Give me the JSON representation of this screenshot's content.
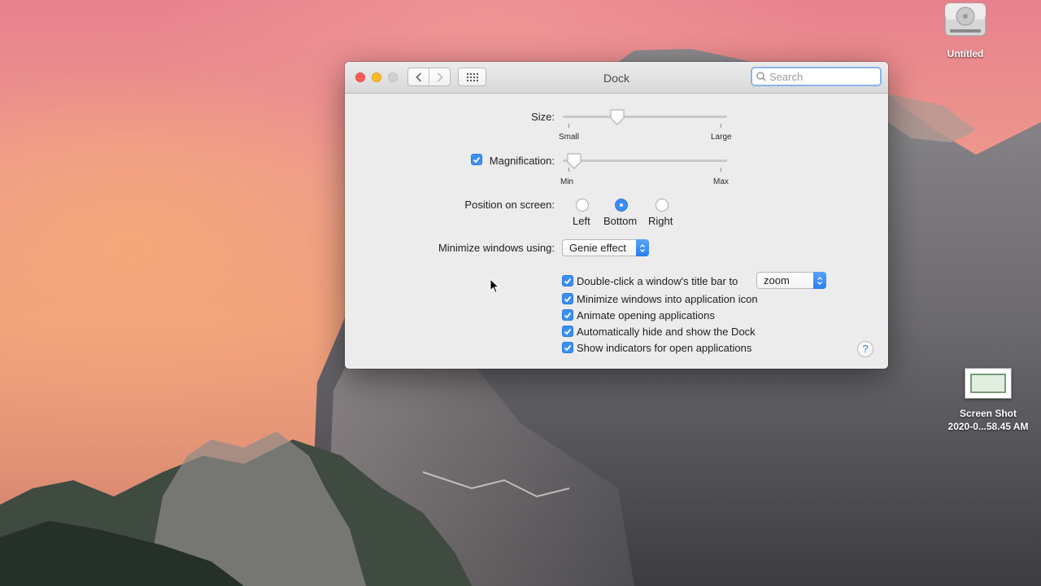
{
  "desktop": {
    "icons": [
      {
        "label": "Untitled",
        "icon": "hard-drive-icon"
      },
      {
        "label_line1": "Screen Shot",
        "label_line2": "2020-0...58.45 AM",
        "icon": "screenshot-file-icon"
      }
    ]
  },
  "window": {
    "title": "Dock",
    "search_placeholder": "Search",
    "size": {
      "label": "Size:",
      "min_label": "Small",
      "max_label": "Large",
      "value": 0.33
    },
    "magnification": {
      "label": "Magnification:",
      "checked": true,
      "min_label": "Min",
      "max_label": "Max",
      "value": 0.07
    },
    "position": {
      "label": "Position on screen:",
      "options": [
        "Left",
        "Bottom",
        "Right"
      ],
      "selected": "Bottom"
    },
    "minimize": {
      "label": "Minimize windows using:",
      "value": "Genie effect"
    },
    "double_click": {
      "label": "Double-click a window's title bar to",
      "value": "zoom",
      "checked": true
    },
    "options": [
      {
        "label": "Minimize windows into application icon",
        "checked": true
      },
      {
        "label": "Animate opening applications",
        "checked": true
      },
      {
        "label": "Automatically hide and show the Dock",
        "checked": true
      },
      {
        "label": "Show indicators for open applications",
        "checked": true
      }
    ],
    "help_label": "?"
  },
  "colors": {
    "accent": "#3b8ef3",
    "close": "#fc5f57",
    "minimize": "#fdbc2e"
  }
}
